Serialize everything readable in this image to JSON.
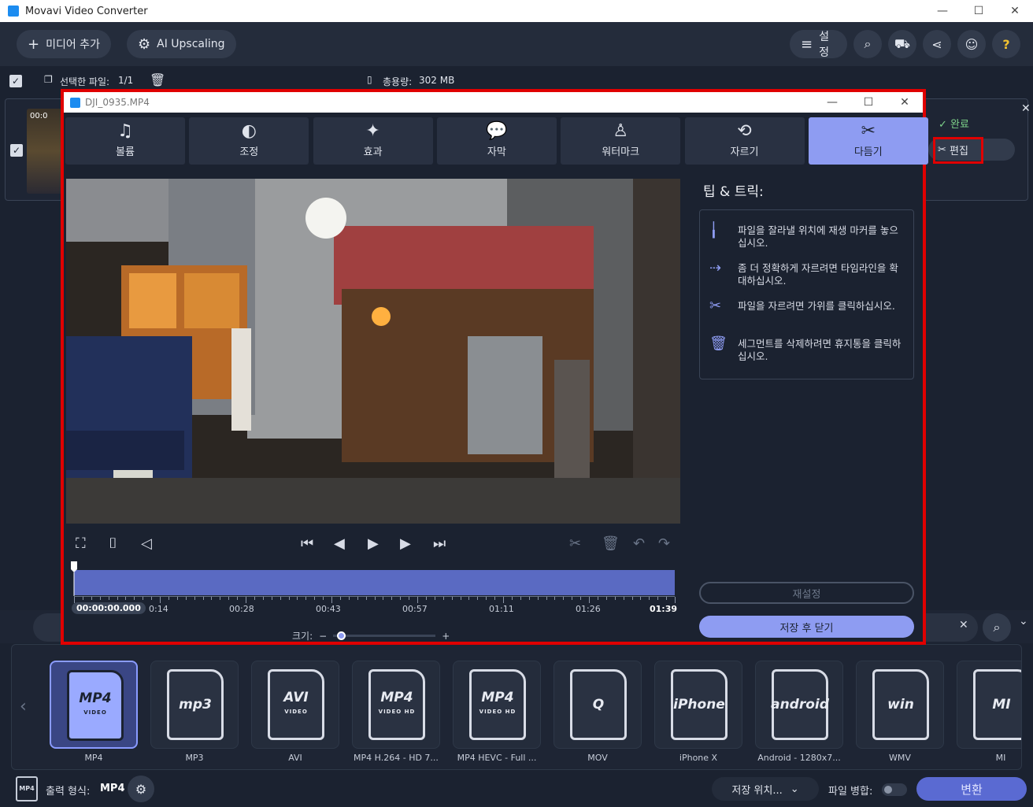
{
  "window": {
    "title": "Movavi Video Converter",
    "controls": [
      "—",
      "☐",
      "✕"
    ]
  },
  "toolbar": {
    "add_media_label": "미디어 추가",
    "ai_upscaling_label": "AI Upscaling",
    "settings_label": "설정"
  },
  "selection": {
    "selected_files_label": "선택한 파일:",
    "selected_files_count": "1/1",
    "total_size_label": "총용량:",
    "total_size": "302 MB"
  },
  "file_row": {
    "thumb_time": "00:0",
    "status_label": "완료",
    "edit_label": "편집"
  },
  "editor": {
    "title": "DJI_0935.MP4",
    "tabs": [
      {
        "label": "볼륨",
        "icon": "music-note-icon"
      },
      {
        "label": "조정",
        "icon": "contrast-icon"
      },
      {
        "label": "효과",
        "icon": "magic-wand-icon"
      },
      {
        "label": "자막",
        "icon": "speech-bubble-icon"
      },
      {
        "label": "워터마크",
        "icon": "stamp-icon"
      },
      {
        "label": "자르기",
        "icon": "rotate-crop-icon"
      },
      {
        "label": "다듬기",
        "icon": "scissors-icon",
        "active": true
      }
    ],
    "tips_title": "팁 & 트릭:",
    "tips": [
      {
        "icon": "marker-icon",
        "text": "파일을 잘라낼 위치에 재생 마커를 놓으십시오."
      },
      {
        "icon": "zoom-timeline-icon",
        "text": "좀 더 정확하게 자르려면 타임라인을 확대하십시오."
      },
      {
        "icon": "scissors-icon",
        "text": "파일을 자르려면 가위를 클릭하십시오."
      },
      {
        "icon": "trash-icon",
        "text": "세그먼트를 삭제하려면 휴지통을 클릭하십시오."
      }
    ],
    "timeline": {
      "current_time": "00:00:00.000",
      "labels": [
        "0:14",
        "00:28",
        "00:43",
        "00:57",
        "01:11",
        "01:26",
        "01:39"
      ],
      "playhead_fraction": 0
    },
    "zoom_label": "크기:",
    "zoom_fraction": 0.05,
    "reset_label": "재설정",
    "save_close_label": "저장 후 닫기"
  },
  "formats": [
    {
      "badge": "MP4",
      "sub": "VIDEO",
      "label": "MP4",
      "selected": true
    },
    {
      "badge": "mp3",
      "sub": "",
      "label": "MP3"
    },
    {
      "badge": "AVI",
      "sub": "VIDEO",
      "label": "AVI"
    },
    {
      "badge": "MP4",
      "sub": "VIDEO HD",
      "label": "MP4 H.264 - HD 7..."
    },
    {
      "badge": "MP4",
      "sub": "VIDEO HD",
      "label": "MP4 HEVC - Full ..."
    },
    {
      "badge": "Q",
      "sub": "",
      "label": "MOV"
    },
    {
      "badge": "iPhone",
      "sub": "",
      "label": "iPhone X"
    },
    {
      "badge": "android",
      "sub": "",
      "label": "Android - 1280x7..."
    },
    {
      "badge": "win",
      "sub": "",
      "label": "WMV"
    },
    {
      "badge": "MI",
      "sub": "",
      "label": "MI"
    }
  ],
  "footer": {
    "output_format_label": "출력 형식:",
    "output_format_value": "MP4",
    "save_location_label": "저장 위치...",
    "merge_label": "파일 병합:",
    "merge_on": false,
    "convert_label": "변환"
  }
}
